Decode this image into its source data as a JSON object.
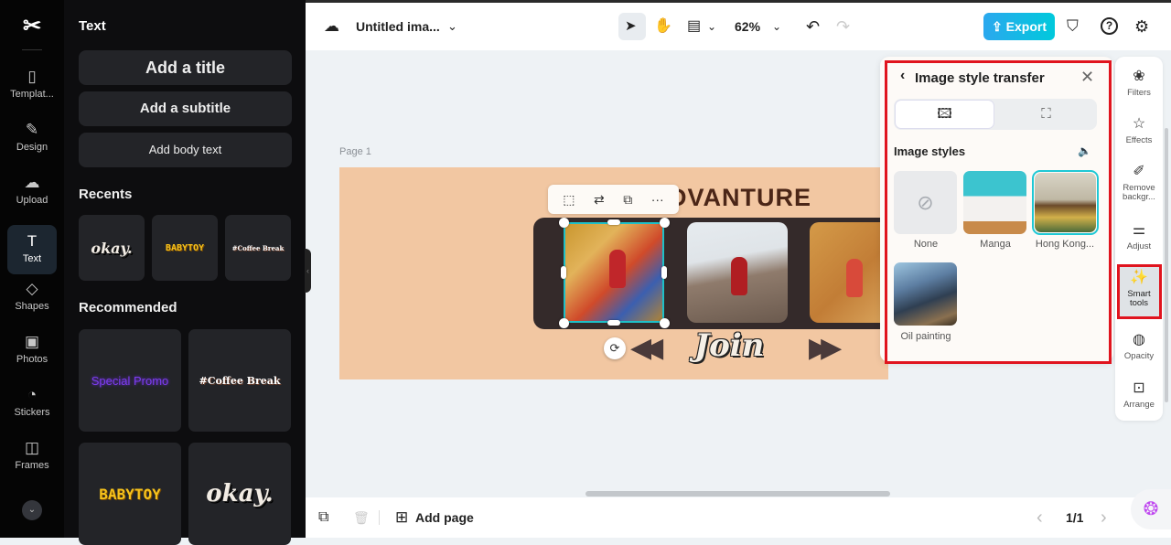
{
  "app": {
    "logo": "capcut-logo"
  },
  "rail": {
    "items": [
      {
        "label": "Templat...",
        "icon": "template-icon",
        "glyph": "▯"
      },
      {
        "label": "Design",
        "icon": "design-icon",
        "glyph": "✎"
      },
      {
        "label": "Upload",
        "icon": "upload-icon",
        "glyph": "☁"
      },
      {
        "label": "Text",
        "icon": "text-icon",
        "glyph": "T",
        "active": true
      },
      {
        "label": "Shapes",
        "icon": "shapes-icon",
        "glyph": "◇"
      },
      {
        "label": "Photos",
        "icon": "photos-icon",
        "glyph": "▣"
      },
      {
        "label": "Stickers",
        "icon": "stickers-icon",
        "glyph": "◔"
      },
      {
        "label": "Frames",
        "icon": "frames-icon",
        "glyph": "◫"
      }
    ],
    "more_glyph": "⌄"
  },
  "text_panel": {
    "title": "Text",
    "add_title": "Add a title",
    "add_subtitle": "Add a subtitle",
    "add_body": "Add body text",
    "recents_label": "Recents",
    "recents": [
      "okay.",
      "BABYTOY",
      "#Coffee Break"
    ],
    "recommended_label": "Recommended",
    "recommended": [
      "Special Promo",
      "#Coffee Break",
      "BABYTOY",
      "okay."
    ]
  },
  "topbar": {
    "doc_name": "Untitled ima...",
    "zoom": "62%",
    "export_label": "Export",
    "icons": {
      "cloud": "☁",
      "chevron": "⌄",
      "pointer": "➤",
      "hand": "✋",
      "layout": "▤",
      "undo": "↶",
      "redo": "↷",
      "shield": "⛉",
      "help": "?",
      "settings": "⚙",
      "export": "⇪"
    }
  },
  "canvas": {
    "page_label": "Page 1",
    "headline": "DVANTURE",
    "join_text": "Join",
    "rewind": "◀◀",
    "forward": "▶▶",
    "rotate_glyph": "⟳",
    "context_menu": [
      "⬚",
      "⇄",
      "⧉",
      "···"
    ]
  },
  "style_panel": {
    "back": "‹",
    "title": "Image style transfer",
    "close": "✕",
    "tab_image": "🖾",
    "tab_portrait": "⛶",
    "section": "Image styles",
    "mute_icon": "🔈",
    "styles": [
      {
        "label": "None",
        "selected": false
      },
      {
        "label": "Manga",
        "selected": false
      },
      {
        "label": "Hong Kong...",
        "selected": true
      },
      {
        "label": "Oil painting",
        "selected": false
      }
    ],
    "none_glyph": "⊘"
  },
  "right_toolbar": {
    "items": [
      {
        "label": "Filters",
        "glyph": "❀"
      },
      {
        "label": "Effects",
        "glyph": "☆"
      },
      {
        "label": "Remove backgr...",
        "glyph": "✐"
      },
      {
        "label": "Adjust",
        "glyph": "⚌"
      },
      {
        "label": "Smart tools",
        "glyph": "✨",
        "active": true
      },
      {
        "label": "Opacity",
        "glyph": "◍"
      },
      {
        "label": "Arrange",
        "glyph": "⊡"
      }
    ]
  },
  "bottom": {
    "add_page": "Add page",
    "page_indicator": "1/1",
    "prev": "‹",
    "next": "›",
    "duplicate_glyph": "⧉",
    "trash_glyph": "🗑",
    "add_page_glyph": "⊞",
    "brain_glyph": "❂"
  }
}
